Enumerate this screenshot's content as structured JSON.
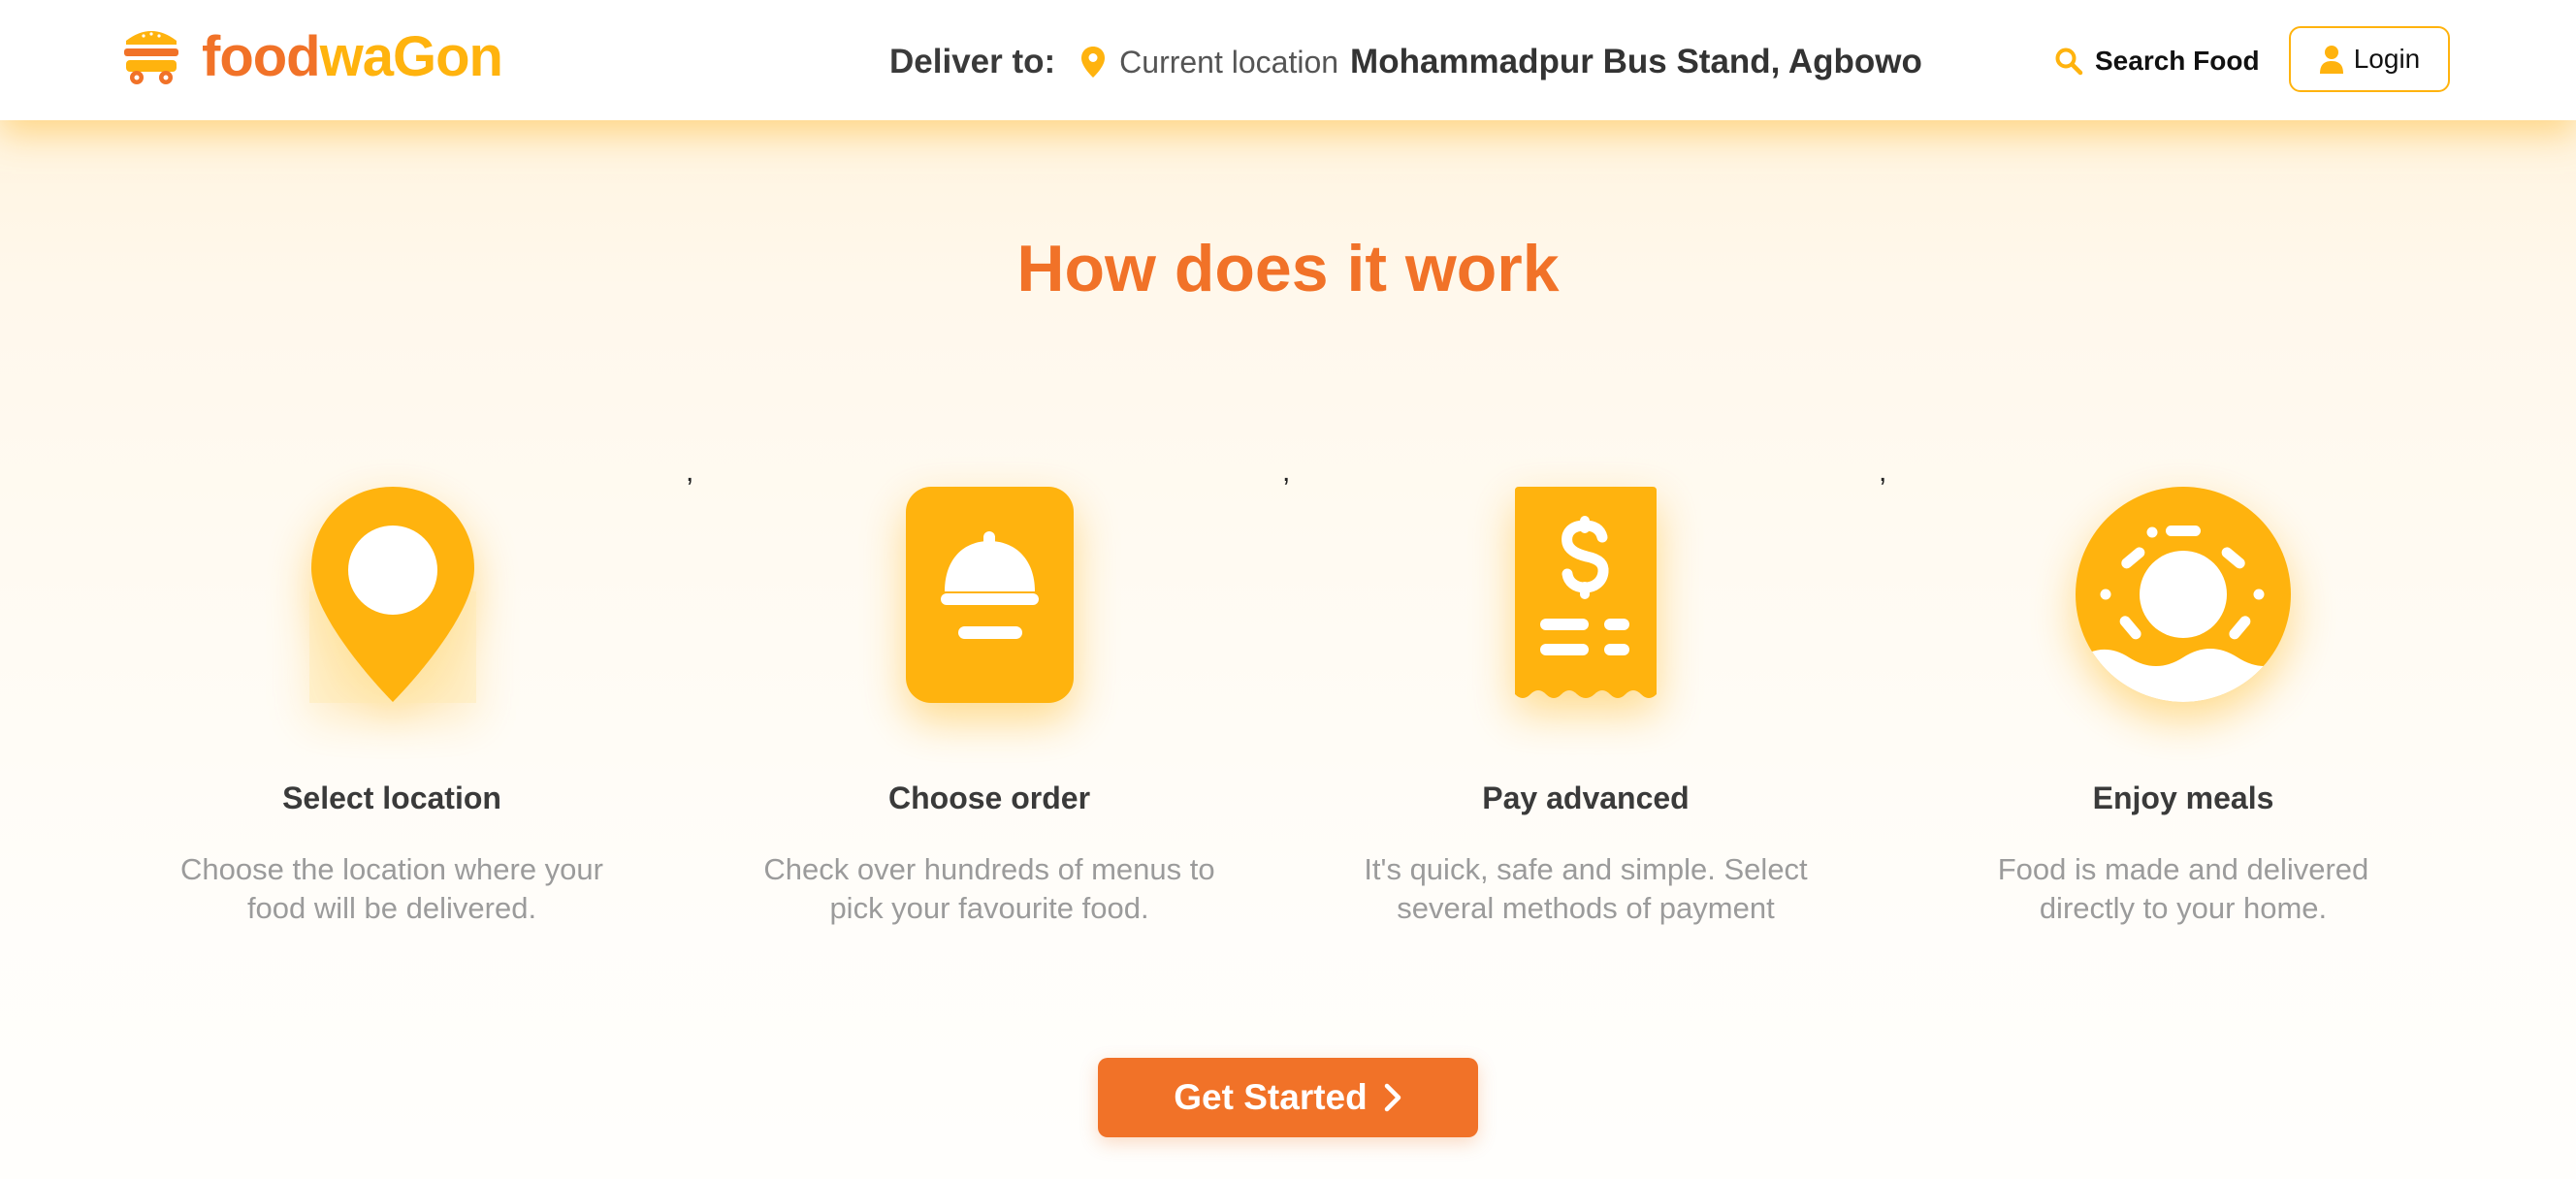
{
  "brand": {
    "name_part1": "food",
    "name_part2": "waGon",
    "icon": "burger-truck-icon"
  },
  "header": {
    "deliver_label": "Deliver to:",
    "current_location_label": "Current location",
    "address": "Mohammadpur Bus Stand, Agbowo",
    "search_label": "Search Food",
    "login_label": "Login"
  },
  "section": {
    "title": "How does it work",
    "separators": [
      ",",
      ",",
      ","
    ],
    "steps": [
      {
        "title": "Select location",
        "description": "Choose the location where your food will be delivered.",
        "icon": "location-pin-icon"
      },
      {
        "title": "Choose order",
        "description": "Check over hundreds of menus to pick your favourite food.",
        "icon": "food-cloche-icon"
      },
      {
        "title": "Pay advanced",
        "description": "It's quick, safe and simple. Select several methods of payment",
        "icon": "receipt-dollar-icon"
      },
      {
        "title": "Enjoy meals",
        "description": "Food is made and delivered directly to your home.",
        "icon": "donut-icon"
      }
    ]
  },
  "cta": {
    "label": "Get Started",
    "icon": "chevron-right-icon"
  },
  "colors": {
    "primary": "#f17228",
    "accent": "#ffb30e",
    "text_dark": "#3a3a3a",
    "text_muted": "#9b9b9b"
  }
}
